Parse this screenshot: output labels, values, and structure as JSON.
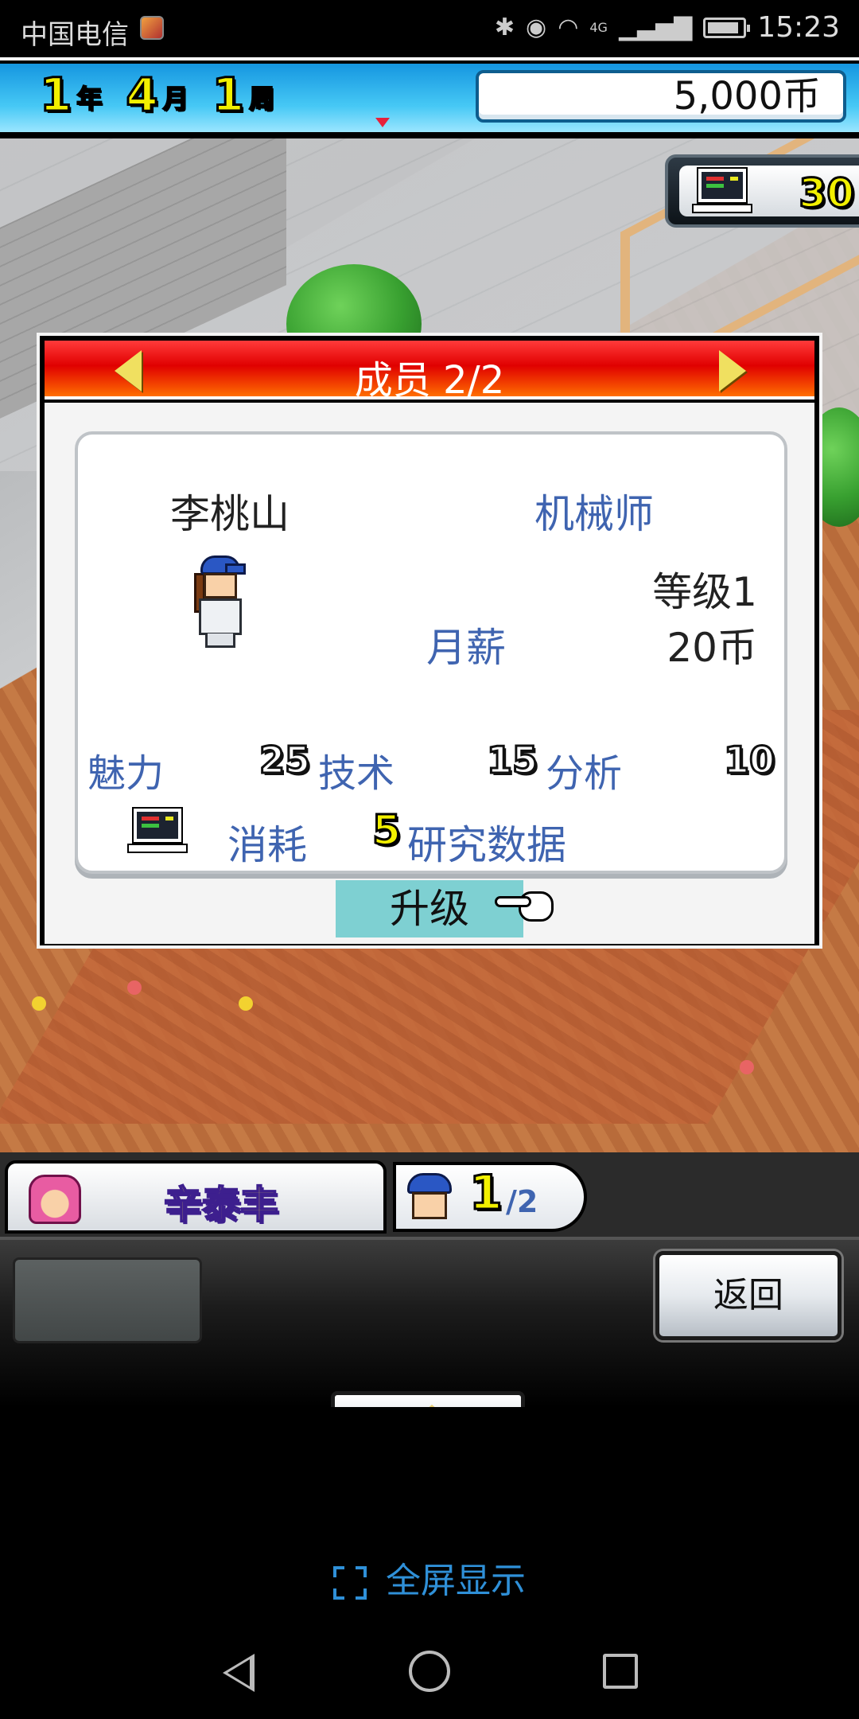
{
  "status_bar": {
    "carrier": "中国电信",
    "network": "4G",
    "time": "15:23"
  },
  "top_bar": {
    "year_value": "1",
    "year_unit": "年",
    "month_value": "4",
    "month_unit": "月",
    "week_value": "1",
    "week_unit": "周",
    "money": "5,000币"
  },
  "research_points": "30",
  "dialog": {
    "title": "成员 2/2",
    "member": {
      "name": "李桃山",
      "job": "机械师",
      "level": "等级1",
      "salary_label": "月薪",
      "salary": "20币",
      "stats": [
        {
          "label": "魅力",
          "value": "25"
        },
        {
          "label": "技术",
          "value": "15"
        },
        {
          "label": "分析",
          "value": "10"
        }
      ],
      "consume_label": "消耗",
      "consume_value": "5",
      "consume_unit": "研究数据"
    },
    "upgrade_label": "升级"
  },
  "bottom": {
    "leader_name": "辛泰丰",
    "crew_current": "1",
    "crew_total": "/2",
    "back_label": "返回"
  },
  "fullscreen_label": "全屏显示",
  "colors": {
    "accent_blue": "#3f64b0",
    "header_red": "#e00000",
    "number_yellow": "#f2f000",
    "upgrade_cyan": "#7ed0d2",
    "link_blue": "#2f90d8"
  }
}
